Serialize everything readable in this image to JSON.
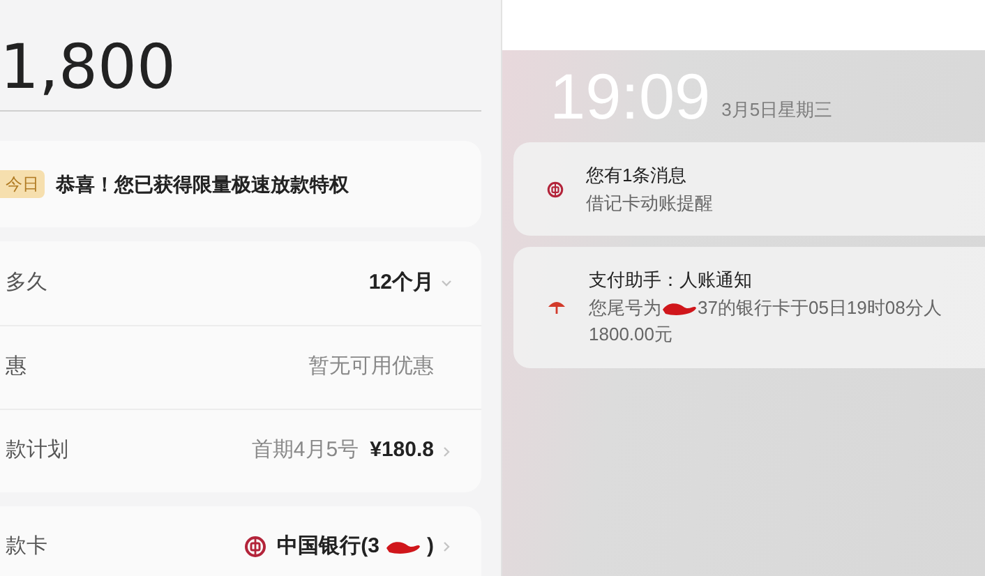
{
  "loan": {
    "amount": "1,800",
    "banner": {
      "badge": "今日",
      "message": "恭喜！您已获得限量极速放款特权"
    },
    "options": [
      {
        "label": "多久",
        "value": "12个月",
        "kind": "dropdown"
      },
      {
        "label": "惠",
        "value": "暂无可用优惠",
        "kind": "plain"
      },
      {
        "label": "款计划",
        "value": "首期4月5号",
        "amount": "¥180.8",
        "kind": "link"
      }
    ],
    "card": {
      "label": "款卡",
      "bank_before": "中国银行(3",
      "bank_after": ")"
    }
  },
  "lock_screen": {
    "time": "19:09",
    "date": "3月5日星期三",
    "notifications": [
      {
        "kind": "bank",
        "title": "您有1条消息",
        "lines": [
          {
            "before": "借记卡动账提醒"
          }
        ]
      },
      {
        "kind": "pay",
        "title": "支付助手：人账通知",
        "lines": [
          {
            "before": "您尾号为",
            "after": "37的银行卡于05日19时08分人"
          },
          {
            "before": "1800.00元"
          }
        ]
      }
    ]
  }
}
